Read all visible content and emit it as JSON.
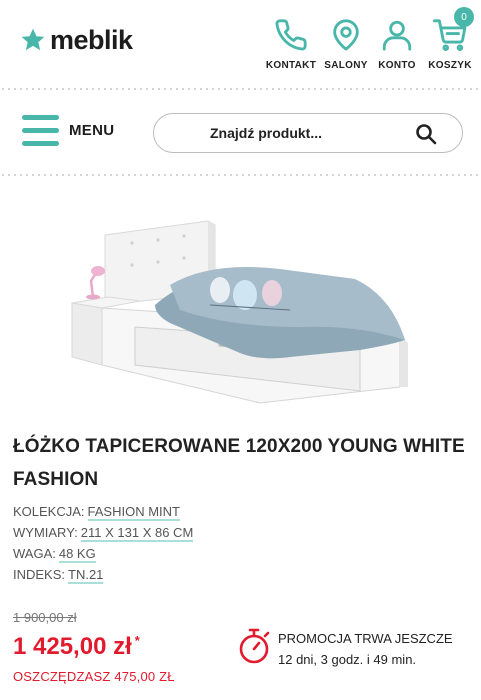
{
  "brand": {
    "name": "meblik",
    "accent_color": "#48b6a9",
    "price_color": "#e01b2d"
  },
  "header": {
    "nav": [
      {
        "label": "KONTAKT",
        "icon": "phone-icon"
      },
      {
        "label": "SALONY",
        "icon": "map-pin-icon"
      },
      {
        "label": "KONTO",
        "icon": "user-icon"
      },
      {
        "label": "KOSZYK",
        "icon": "cart-icon",
        "badge": "0"
      }
    ]
  },
  "menu": {
    "label": "MENU",
    "icon": "hamburger-icon"
  },
  "search": {
    "placeholder": "Znajdź produkt...",
    "icon": "search-icon"
  },
  "product": {
    "title": "ŁÓŻKO TAPICEROWANE 120X200 YOUNG WHITE FASHION",
    "image_alt": "bed-with-trundle-drawer-image",
    "specs": [
      {
        "label": "KOLEKCJA:",
        "value": "FASHION MINT"
      },
      {
        "label": "WYMIARY:",
        "value": "211 X 131 X 86 CM"
      },
      {
        "label": "WAGA:",
        "value": "48 KG"
      },
      {
        "label": "INDEKS:",
        "value": "TN.21"
      }
    ],
    "old_price": "1 900,00 zł",
    "price": "1 425,00 zł",
    "price_asterisk": "*",
    "saving": "OSZCZĘDZASZ 475,00 ZŁ",
    "promo": {
      "line1": "PROMOCJA TRWA JESZCZE",
      "line2": "12 dni, 3 godz. i 49 min.",
      "icon": "stopwatch-icon"
    }
  }
}
